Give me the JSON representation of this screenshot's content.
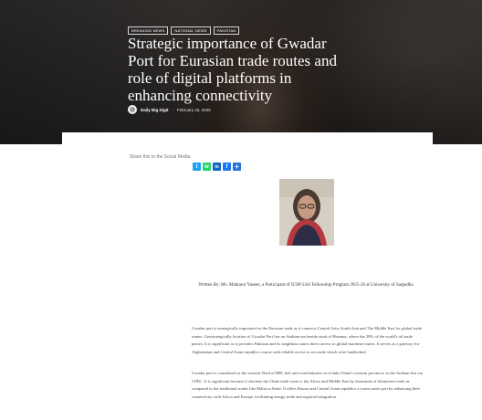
{
  "hero": {
    "tags": [
      "BREAKING NEWS",
      "NATIONAL NEWS",
      "PAKISTAN"
    ],
    "title": "Strategic importance of Gwadar Port for Eurasian trade routes and role of digital platforms in enhancing connectivity",
    "author": "Daily Big Digit",
    "date": "February 18, 2025"
  },
  "share": {
    "label": "Share this to the Social Media",
    "buttons": [
      {
        "name": "twitter",
        "glyph": "t",
        "color": "#1da1f2"
      },
      {
        "name": "whatsapp",
        "glyph": "w",
        "color": "#25d366"
      },
      {
        "name": "linkedin",
        "glyph": "in",
        "color": "#0a66c2"
      },
      {
        "name": "facebook",
        "glyph": "f",
        "color": "#1877f2"
      },
      {
        "name": "share-more",
        "glyph": "+",
        "color": "#2f6fd8"
      }
    ]
  },
  "article": {
    "caption": "Written By: Ms. Mahnoor Yaseen, a Participant of ICSP-UoS Fellowship Program 2025-26 at University of Sargodha",
    "paragraphs": [
      "Gwadar port is strategically important for the Eurasian trade as it connects Central Asia, South Asia and The Middle East for global trade routes. Geostrategically location of Gwadar Port lies on Arabian sea beside strait of Hormuz, where the 20% of the world's oil trade passes. It is significant as it provides Pakistan and its neighbour states direct access to global maritime routes. It serves as a gateway for Afghanistan and Central Asian republics course seek reliable access to sea trade which were landlocked.",
      "Gwadar port is considered as the western Nerd of BRI, belt and road initiative as it links China's western provinces to the Arabian Sea via CPEC. It is significant because it shortens the China trade route to the Africa and Middle East by thousands of kilometres trade as compared to the traditional routes like Malacca Strait. It offers Russia and Central Asian republics a warm water port by enhancing their connectivity with Africa and Europe, facilitating energy trade and regional integration."
    ]
  }
}
